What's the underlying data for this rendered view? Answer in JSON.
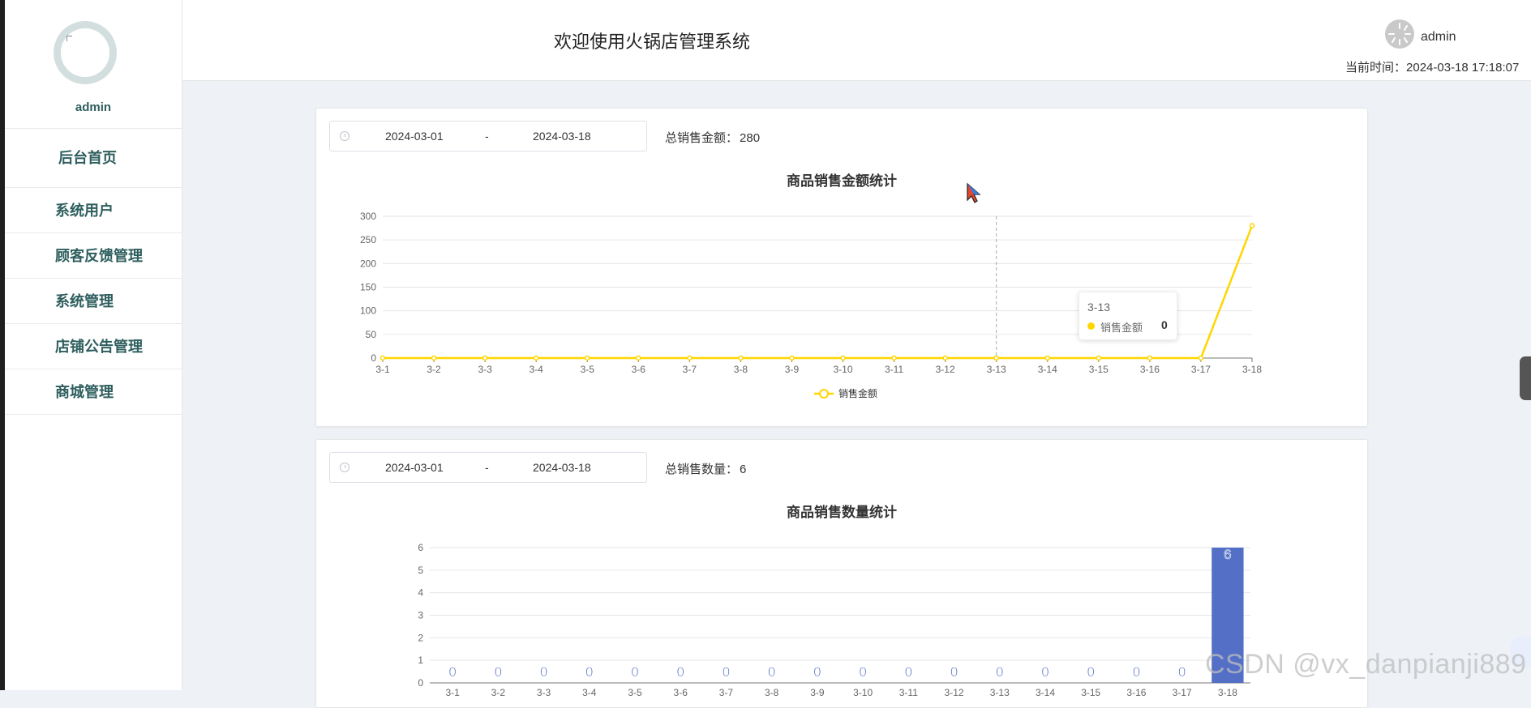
{
  "sidebar": {
    "username": "admin",
    "items": [
      {
        "label": "后台首页"
      },
      {
        "label": "系统用户"
      },
      {
        "label": "顾客反馈管理"
      },
      {
        "label": "系统管理"
      },
      {
        "label": "店铺公告管理"
      },
      {
        "label": "商城管理"
      }
    ]
  },
  "header": {
    "title": "欢迎使用火锅店管理系统",
    "username": "admin",
    "time_label": "当前时间：",
    "time_value": "2024-03-18 17:18:07"
  },
  "sales_amount_panel": {
    "date_start": "2024-03-01",
    "date_sep": "-",
    "date_end": "2024-03-18",
    "total_label": "总销售金额：",
    "total_value": "280",
    "tooltip": {
      "title": "3-13",
      "label": "销售金额",
      "value": "0"
    }
  },
  "sales_qty_panel": {
    "date_start": "2024-03-01",
    "date_sep": "-",
    "date_end": "2024-03-18",
    "total_label": "总销售数量：",
    "total_value": "6"
  },
  "watermark": "CSDN @vx_danpianji889",
  "colors": {
    "line": "#ffd600",
    "bar": "#5470c6",
    "sidebar_text": "#2f5e5e"
  },
  "chart_data": [
    {
      "type": "line",
      "title": "商品销售金额统计",
      "categories": [
        "3-1",
        "3-2",
        "3-3",
        "3-4",
        "3-5",
        "3-6",
        "3-7",
        "3-8",
        "3-9",
        "3-10",
        "3-11",
        "3-12",
        "3-13",
        "3-14",
        "3-15",
        "3-16",
        "3-17",
        "3-18"
      ],
      "series": [
        {
          "name": "销售金额",
          "values": [
            0,
            0,
            0,
            0,
            0,
            0,
            0,
            0,
            0,
            0,
            0,
            0,
            0,
            0,
            0,
            0,
            0,
            280
          ]
        }
      ],
      "yticks": [
        0,
        50,
        100,
        150,
        200,
        250,
        300
      ],
      "ylim": [
        0,
        300
      ],
      "grid": true,
      "legend": "bottom-center"
    },
    {
      "type": "bar",
      "title": "商品销售数量统计",
      "categories": [
        "3-1",
        "3-2",
        "3-3",
        "3-4",
        "3-5",
        "3-6",
        "3-7",
        "3-8",
        "3-9",
        "3-10",
        "3-11",
        "3-12",
        "3-13",
        "3-14",
        "3-15",
        "3-16",
        "3-17",
        "3-18"
      ],
      "values": [
        0,
        0,
        0,
        0,
        0,
        0,
        0,
        0,
        0,
        0,
        0,
        0,
        0,
        0,
        0,
        0,
        0,
        6
      ],
      "yticks": [
        0,
        1,
        2,
        3,
        4,
        5,
        6
      ],
      "ylim": [
        0,
        6
      ],
      "grid": true,
      "value_labels": true
    }
  ]
}
